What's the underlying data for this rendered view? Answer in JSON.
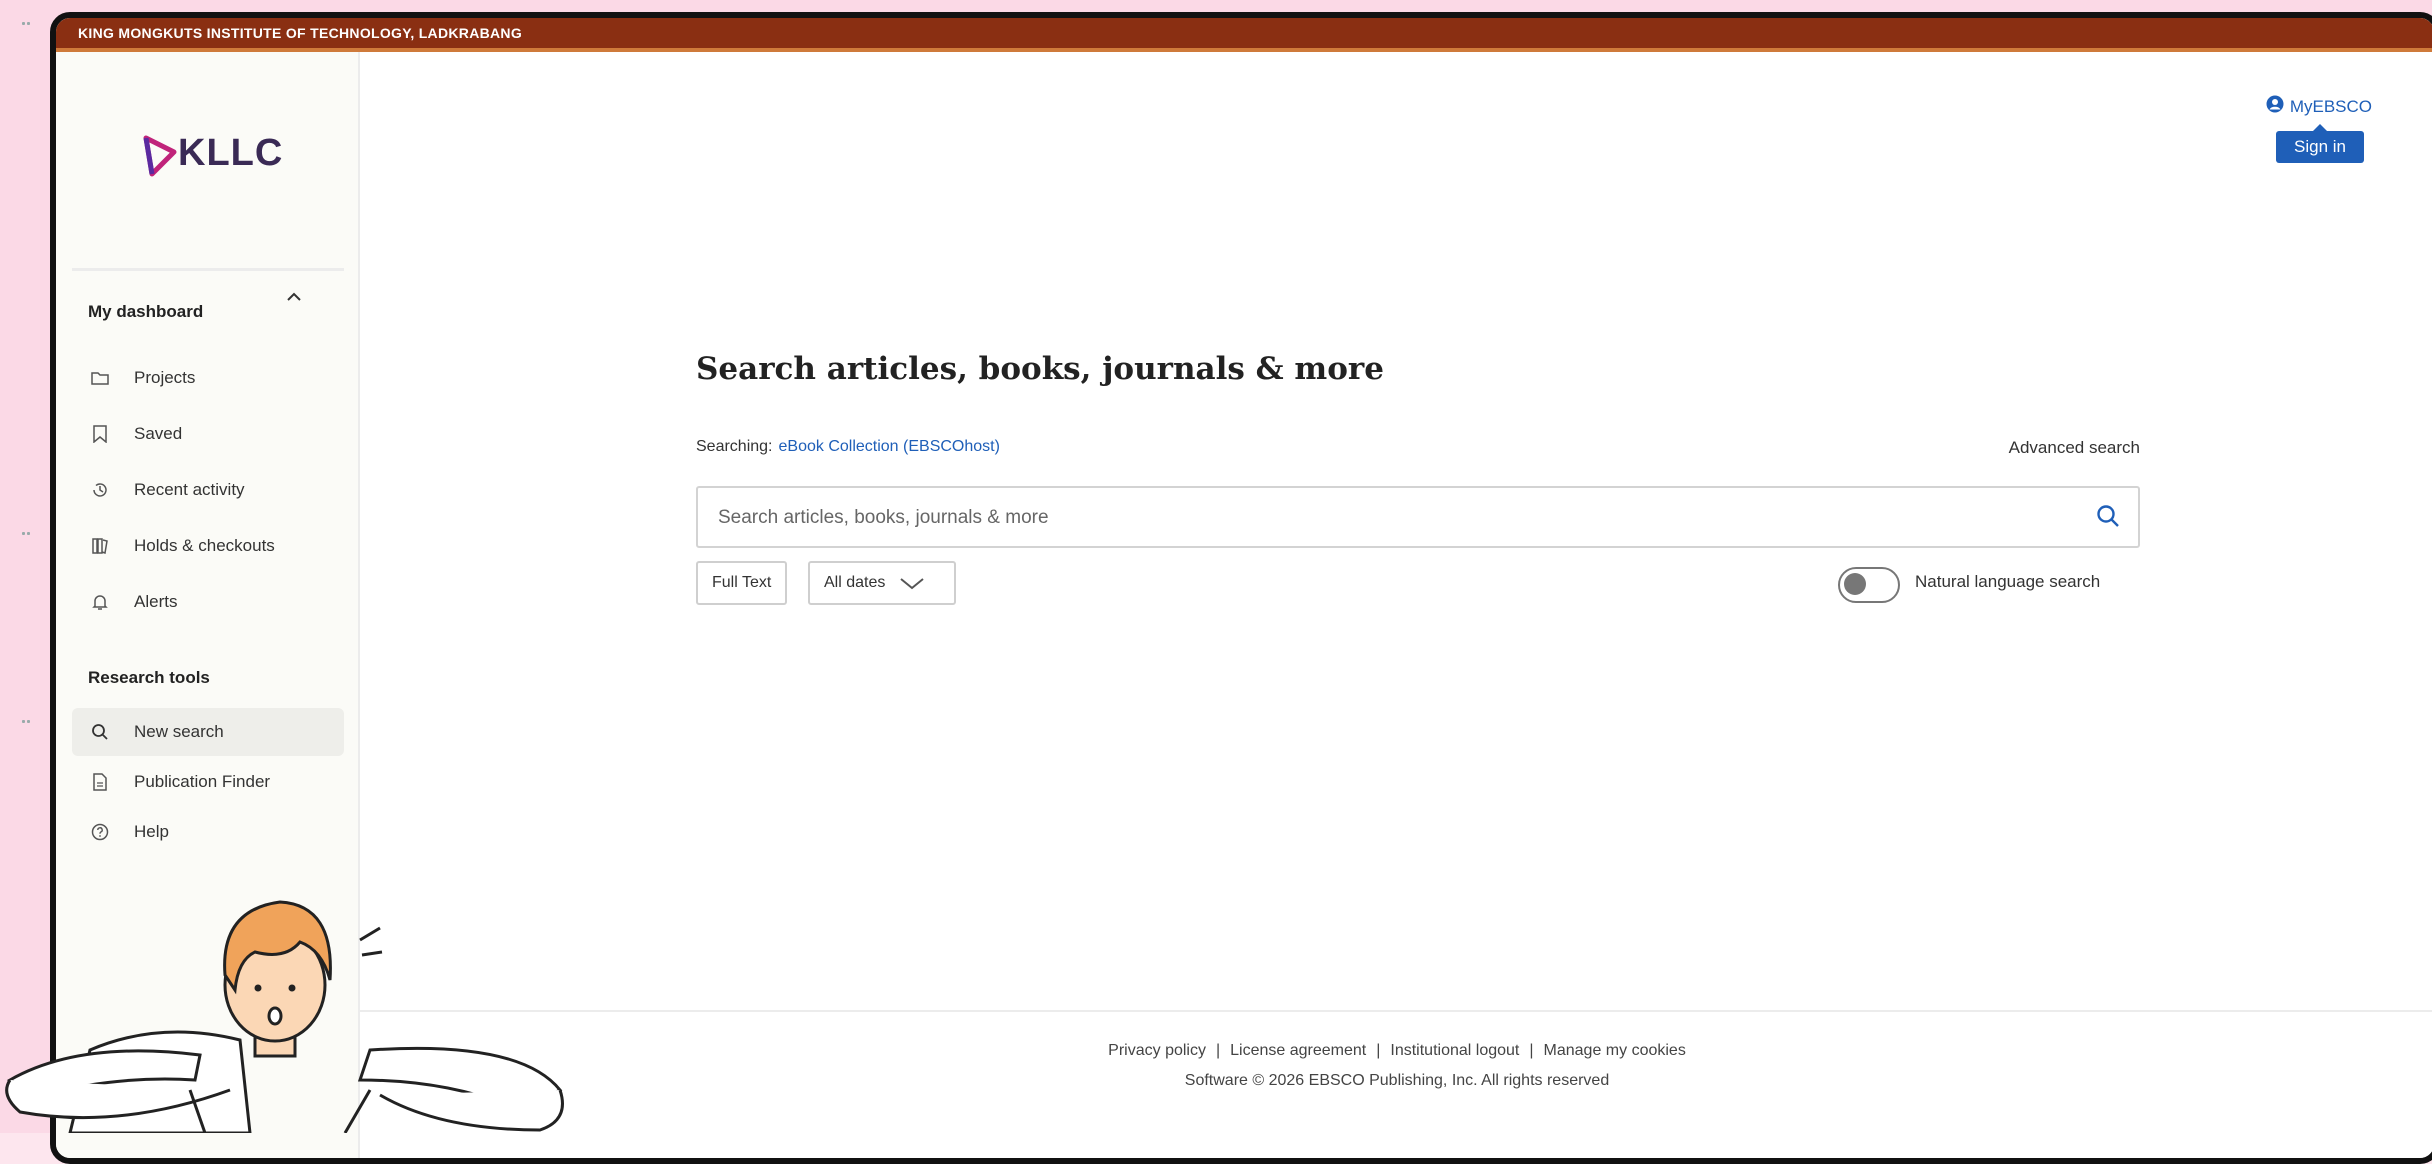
{
  "institution_bar": "KING MONGKUTS INSTITUTE OF TECHNOLOGY, LADKRABANG",
  "logo": {
    "text": "KLLC"
  },
  "sidebar": {
    "dashboard_heading": "My dashboard",
    "dashboard_items": [
      {
        "label": "Projects",
        "icon": "folder-icon"
      },
      {
        "label": "Saved",
        "icon": "bookmark-icon"
      },
      {
        "label": "Recent activity",
        "icon": "history-icon"
      },
      {
        "label": "Holds & checkouts",
        "icon": "books-icon"
      },
      {
        "label": "Alerts",
        "icon": "bell-icon"
      }
    ],
    "research_heading": "Research tools",
    "research_items": [
      {
        "label": "New search",
        "icon": "search-icon"
      },
      {
        "label": "Publication Finder",
        "icon": "document-icon"
      },
      {
        "label": "Help",
        "icon": "help-icon"
      }
    ]
  },
  "header": {
    "myebsco_label": "MyEBSCO",
    "signin_label": "Sign in"
  },
  "search": {
    "title": "Search articles, books, journals & more",
    "searching_label": "Searching:",
    "database": "eBook Collection (EBSCOhost)",
    "advanced_label": "Advanced search",
    "placeholder": "Search articles, books, journals & more",
    "value": "",
    "full_text_label": "Full Text",
    "dates_label": "All dates",
    "natural_language_label": "Natural language search",
    "natural_language_enabled": false
  },
  "footer": {
    "links": [
      "Privacy policy",
      "License agreement",
      "Institutional logout",
      "Manage my cookies"
    ],
    "copyright": "Software © 2026 EBSCO Publishing, Inc. All rights reserved"
  },
  "colors": {
    "top_bar": "#8a2f12",
    "link_blue": "#1f5fb8",
    "page_bg": "#fbd9e6"
  }
}
